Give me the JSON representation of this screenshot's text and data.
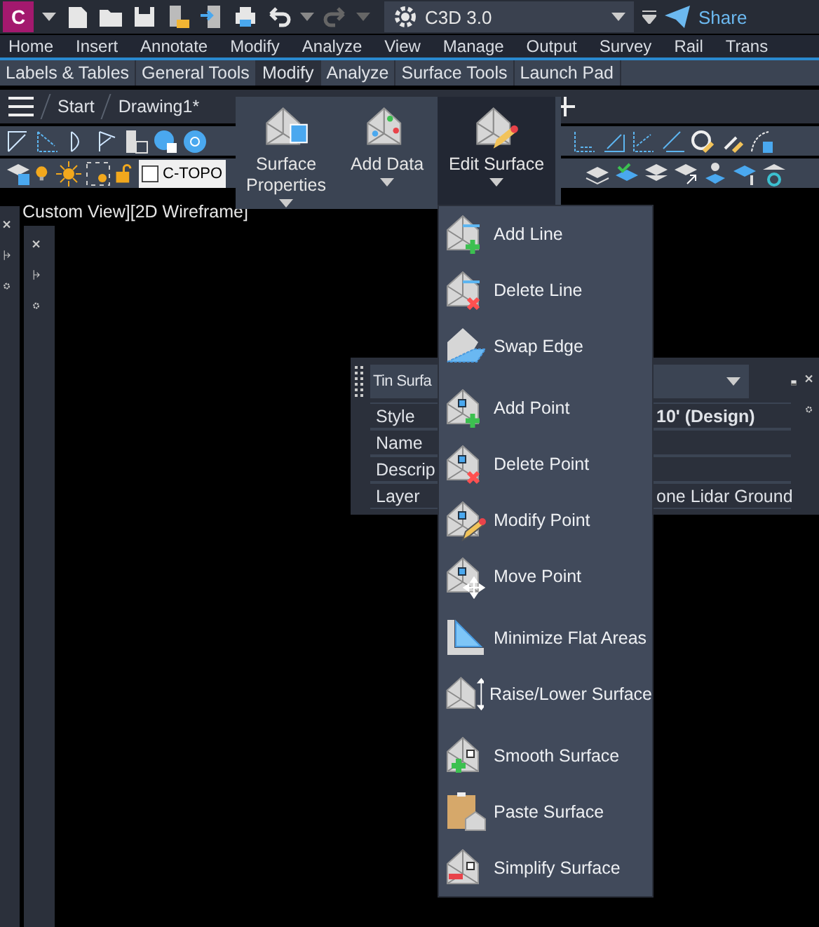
{
  "quick_access": {
    "logo": "C",
    "workspace": "C3D 3.0",
    "share": "Share"
  },
  "ribbon_tabs": [
    {
      "label": "Home",
      "selected": false
    },
    {
      "label": "Insert",
      "selected": false
    },
    {
      "label": "Annotate",
      "selected": false
    },
    {
      "label": "Modify",
      "selected": false
    },
    {
      "label": "Analyze",
      "selected": false
    },
    {
      "label": "View",
      "selected": false
    },
    {
      "label": "Manage",
      "selected": false
    },
    {
      "label": "Output",
      "selected": false
    },
    {
      "label": "Survey",
      "selected": false
    },
    {
      "label": "Rail",
      "selected": false
    },
    {
      "label": "Trans",
      "selected": false
    }
  ],
  "panel_tabs": [
    {
      "label": "Labels & Tables",
      "selected": false
    },
    {
      "label": "General Tools",
      "selected": false
    },
    {
      "label": "Modify",
      "selected": true
    },
    {
      "label": "Analyze",
      "selected": false
    },
    {
      "label": "Surface Tools",
      "selected": false
    },
    {
      "label": "Launch Pad",
      "selected": false
    }
  ],
  "file_tabs": [
    {
      "label": "Start"
    },
    {
      "label": "Drawing1*"
    }
  ],
  "layer_control": {
    "name": "C-TOPO"
  },
  "ribbon_panel": {
    "buttons": [
      {
        "label": "Surface Properties",
        "selected": false
      },
      {
        "label": "Add Data",
        "selected": false
      },
      {
        "label": "Edit Surface",
        "selected": true
      }
    ]
  },
  "viewport_label": "Custom View][2D Wireframe]",
  "menu": {
    "groups": [
      [
        {
          "label": "Add Line"
        },
        {
          "label": "Delete Line"
        },
        {
          "label": "Swap Edge"
        }
      ],
      [
        {
          "label": "Add Point"
        },
        {
          "label": "Delete Point"
        },
        {
          "label": "Modify Point"
        },
        {
          "label": "Move Point"
        }
      ],
      [
        {
          "label": "Minimize Flat Areas"
        },
        {
          "label": "Raise/Lower Surface"
        }
      ],
      [
        {
          "label": "Smooth Surface"
        },
        {
          "label": "Paste Surface"
        },
        {
          "label": "Simplify Surface"
        }
      ]
    ]
  },
  "properties": {
    "selector": "Tin Surfa",
    "rows": [
      {
        "name": "Style",
        "value": "10' (Design)"
      },
      {
        "name": "Name"
      },
      {
        "name": "Descrip"
      },
      {
        "name": "Layer",
        "value": "one Lidar Ground"
      }
    ]
  }
}
